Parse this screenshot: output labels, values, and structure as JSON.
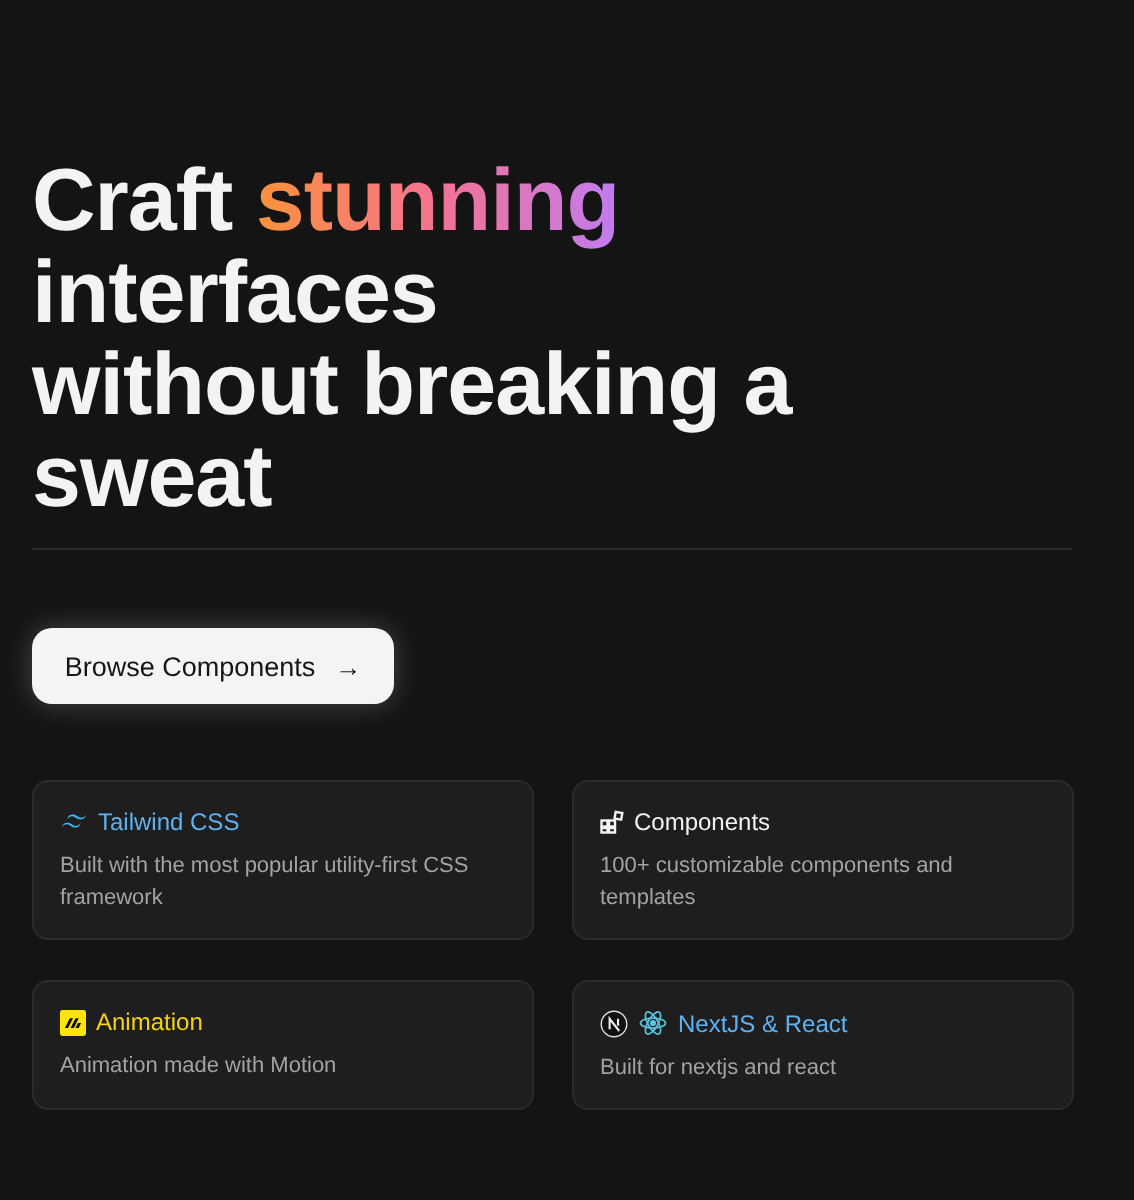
{
  "headline": {
    "lines": [
      {
        "before": "Craft ",
        "highlight": "stunning"
      },
      {
        "before": "interfaces"
      },
      {
        "before": "without breaking a"
      },
      {
        "before": "sweat"
      }
    ]
  },
  "cta": {
    "label": "Browse Components",
    "arrow": "→"
  },
  "features": [
    {
      "kind": "tailwind",
      "title": "Tailwind CSS",
      "color": "#5fb2f2",
      "description": "Built with the most popular utility-first CSS framework"
    },
    {
      "kind": "blocks",
      "title": "Components",
      "color": "#f2f2f2",
      "description": "100+ customizable components and templates"
    },
    {
      "kind": "motion",
      "title": "Animation",
      "color": "#f5d20a",
      "description": "Animation made with Motion"
    },
    {
      "kind": "next-react",
      "title": "NextJS & React",
      "color": "#5fb2f2",
      "description": "Built for nextjs and react"
    }
  ]
}
